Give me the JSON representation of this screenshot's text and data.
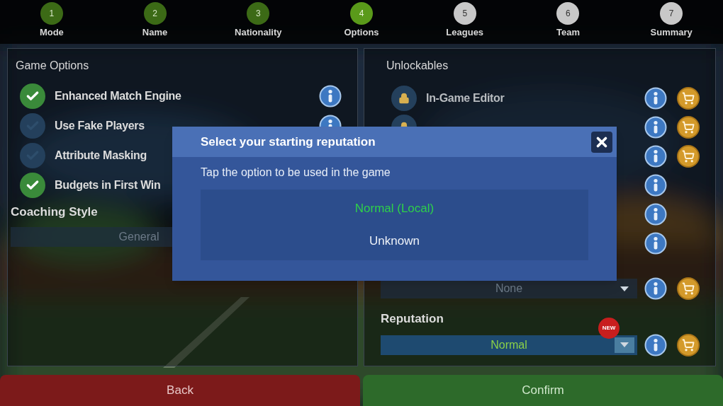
{
  "steps": [
    {
      "number": "1",
      "label": "Mode",
      "done": true,
      "selected": false
    },
    {
      "number": "2",
      "label": "Name",
      "done": true,
      "selected": false
    },
    {
      "number": "3",
      "label": "Nationality",
      "done": true,
      "selected": false
    },
    {
      "number": "4",
      "label": "Options",
      "done": true,
      "selected": true
    },
    {
      "number": "5",
      "label": "Leagues",
      "done": false,
      "selected": false
    },
    {
      "number": "6",
      "label": "Team",
      "done": false,
      "selected": false
    },
    {
      "number": "7",
      "label": "Summary",
      "done": false,
      "selected": false
    }
  ],
  "game_options": {
    "title": "Game Options",
    "items": [
      {
        "label": "Enhanced Match Engine",
        "checked": true,
        "info": true
      },
      {
        "label": "Use Fake Players",
        "checked": false,
        "info": true
      },
      {
        "label": "Attribute Masking",
        "checked": false
      },
      {
        "label": "Budgets in First Win",
        "checked": true
      }
    ],
    "coaching_style": {
      "label": "Coaching Style",
      "value": "General",
      "disabled": true
    }
  },
  "unlockables": {
    "title": "Unlockables",
    "items": [
      {
        "label": "In-Game Editor",
        "locked": true,
        "shop": true
      },
      {
        "locked": true,
        "shop": true
      },
      {
        "shop": true
      },
      {
        "shop": false
      },
      {
        "shop": false
      },
      {
        "shop": false
      }
    ],
    "dropdowns": [
      {
        "value": "None",
        "disabled": true,
        "new": false
      },
      {
        "label": "Reputation",
        "value": "Normal",
        "disabled": false,
        "new": true,
        "badge": "NEW"
      }
    ]
  },
  "dialog": {
    "title": "Select your starting reputation",
    "message": "Tap the option to be used in the game",
    "options": [
      {
        "label": "Normal (Local)",
        "selected": true
      },
      {
        "label": "Unknown",
        "selected": false
      }
    ]
  },
  "buttons": [
    {
      "label": "Back",
      "kind": "back"
    },
    {
      "label": "Confirm",
      "kind": "confirm"
    }
  ]
}
